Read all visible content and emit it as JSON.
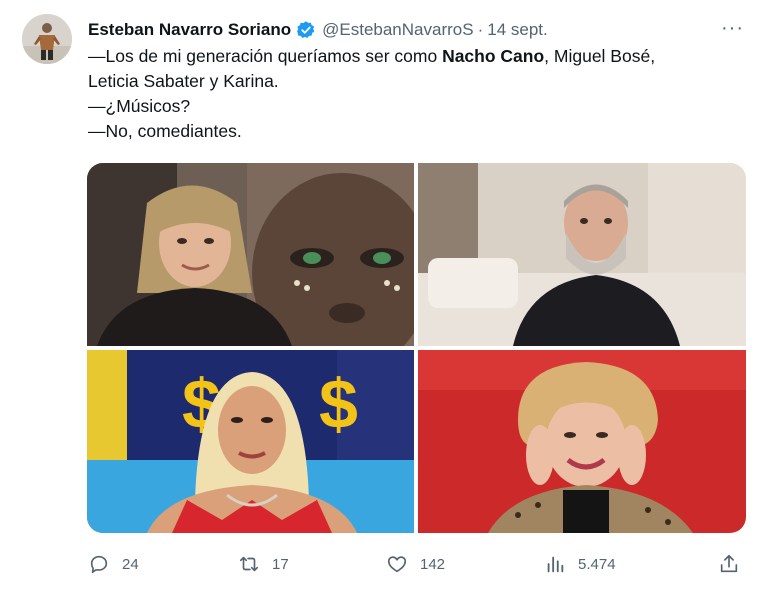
{
  "tweet": {
    "author_name": "Esteban Navarro Soriano",
    "handle": "@EstebanNavarroS",
    "separator": "·",
    "date": "14 sept.",
    "more_label": "···",
    "text": {
      "line1_before": "—Los de mi generación queríamos ser como ",
      "line1_bold": "Nacho Cano",
      "line1_after": ", Miguel Bosé,",
      "line2": "Leticia Sabater y Karina.",
      "line3": "—¿Músicos?",
      "line4": "—No, comediantes."
    },
    "images": [
      {
        "icon": "photo-man-long-hair"
      },
      {
        "icon": "photo-bearded-man"
      },
      {
        "icon": "photo-woman-dollar-signs"
      },
      {
        "icon": "photo-smiling-woman"
      }
    ]
  },
  "actions": {
    "replies": "24",
    "retweets": "17",
    "likes": "142",
    "views": "5.474"
  },
  "colors": {
    "text": "#0f1419",
    "secondary": "#536471",
    "verified": "#1d9bf0"
  }
}
